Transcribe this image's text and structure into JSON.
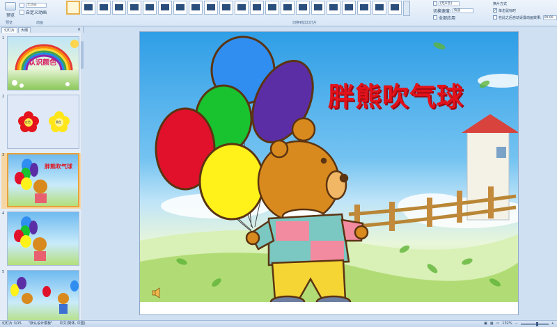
{
  "ribbon": {
    "preview_label": "预览",
    "animation": {
      "dropdown_value": "无动画",
      "custom_label": "自定义动画"
    },
    "group_labels": {
      "preview": "预览",
      "animation": "动画",
      "transition": "切换到此幻灯片"
    },
    "transition_options": {
      "sound_value": "[无声音]",
      "speed_label": "切换速度:",
      "speed_value": "快速",
      "apply_all": "全部应用"
    },
    "advance": {
      "title": "换片方式",
      "on_click": "单击鼠标时",
      "after_label": "在此之后自动设置动画效果:",
      "after_value": "00:00"
    }
  },
  "panel": {
    "tab_slides": "幻灯片",
    "tab_outline": "大纲",
    "close": "×",
    "slides": [
      {
        "num": "1",
        "title": "认识颜色"
      },
      {
        "num": "2",
        "label_a": "红色",
        "label_b": "黄色"
      },
      {
        "num": "3",
        "title": "胖熊吹气球"
      },
      {
        "num": "4"
      },
      {
        "num": "5"
      }
    ]
  },
  "slide": {
    "title": "胖熊吹气球"
  },
  "status": {
    "slide_info": "幻灯片 3/15",
    "theme": "\"默认设计模板\"",
    "language": "中文(简体, 中国)",
    "zoom": "132%"
  },
  "colors": {
    "balloon_blue": "#2f8ef0",
    "balloon_purple": "#5b2ea6",
    "balloon_green": "#19c22f",
    "balloon_red": "#e1112b",
    "balloon_yellow": "#fff21a",
    "title_red": "#e2121b",
    "bear_brown": "#d98a1e"
  }
}
